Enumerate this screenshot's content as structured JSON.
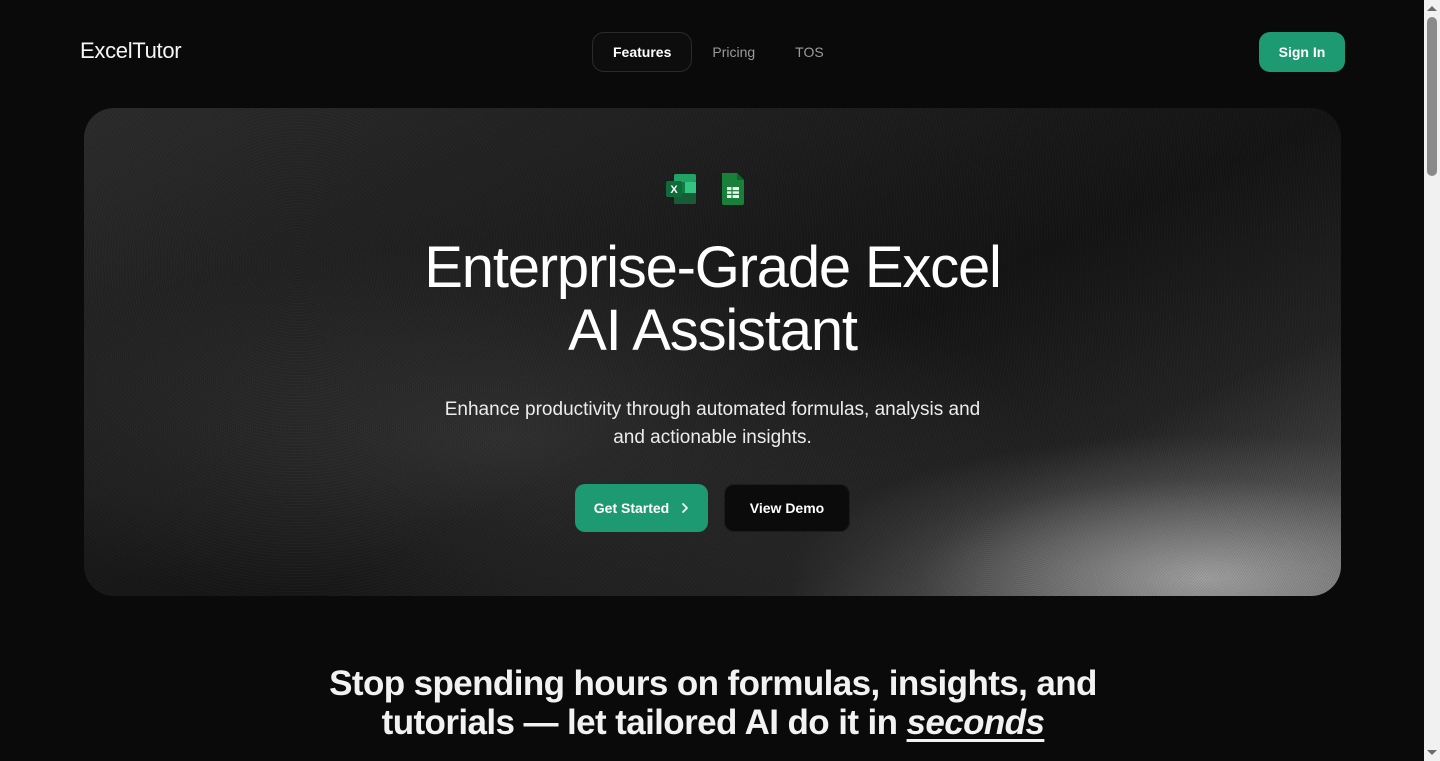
{
  "header": {
    "logo": "ExcelTutor",
    "nav": [
      {
        "label": "Features",
        "active": true
      },
      {
        "label": "Pricing",
        "active": false
      },
      {
        "label": "TOS",
        "active": false
      }
    ],
    "sign_in_label": "Sign In"
  },
  "hero": {
    "icons": [
      "excel-icon",
      "google-sheets-icon"
    ],
    "title_line1": "Enterprise-Grade Excel",
    "title_line2": "AI Assistant",
    "subtitle_line1": "Enhance productivity through automated formulas, analysis and",
    "subtitle_line2": "and actionable insights.",
    "primary_button": "Get Started",
    "secondary_button": "View Demo"
  },
  "tagline": {
    "line1": "Stop spending hours on formulas, insights, and",
    "line2_prefix": "tutorials — let tailored AI do it in ",
    "line2_emphasis": "seconds"
  },
  "colors": {
    "accent": "#1e9a72",
    "background": "#0a0a0a",
    "excel_green": "#107c41",
    "sheets_green": "#188038"
  }
}
